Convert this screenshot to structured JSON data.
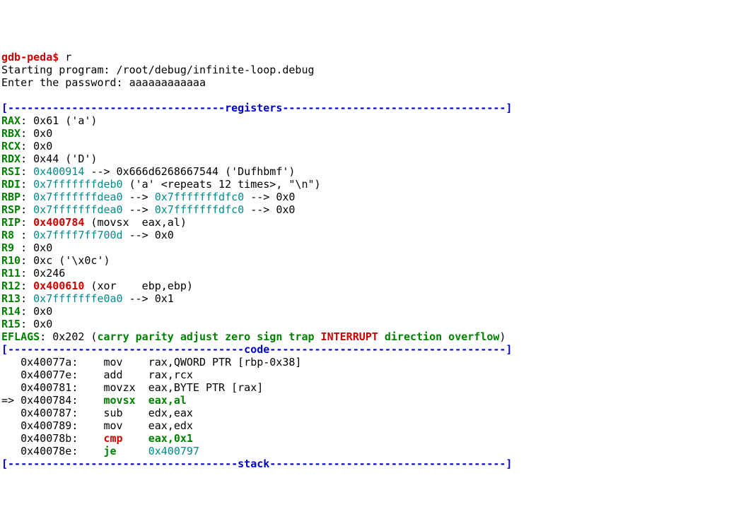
{
  "prompt": {
    "gdb": "gdb-peda$",
    "cmd": " r"
  },
  "lines": {
    "starting": "Starting program: /root/debug/infinite-loop.debug",
    "enterpw": "Enter the password: aaaaaaaaaaaa"
  },
  "blank": "",
  "sections": {
    "registers": "[----------------------------------registers-----------------------------------]",
    "code": "[-------------------------------------code-------------------------------------]",
    "stack": "[------------------------------------stack-------------------------------------]"
  },
  "reg": {
    "RAX": {
      "name": "RAX",
      "rest": ": 0x61 ('a')"
    },
    "RBX": {
      "name": "RBX",
      "rest": ": 0x0 "
    },
    "RCX": {
      "name": "RCX",
      "rest": ": 0x0 "
    },
    "RDX": {
      "name": "RDX",
      "rest": ": 0x44 ('D')"
    },
    "RSI": {
      "name": "RSI",
      "colon": ": ",
      "addr": "0x400914",
      "rest": " --> 0x666d6268667544 ('Dufhbmf')"
    },
    "RDI": {
      "name": "RDI",
      "colon": ": ",
      "addr": "0x7fffffffdeb0",
      "rest": " ('a' <repeats 12 times>, \"\\n\")"
    },
    "RBP": {
      "name": "RBP",
      "colon": ": ",
      "addr": "0x7fffffffdea0",
      "arrow1": " --> ",
      "addr2": "0x7fffffffdfc0",
      "rest": " --> 0x0 "
    },
    "RSP": {
      "name": "RSP",
      "colon": ": ",
      "addr": "0x7fffffffdea0",
      "arrow1": " --> ",
      "addr2": "0x7fffffffdfc0",
      "rest": " --> 0x0 "
    },
    "RIP": {
      "name": "RIP",
      "colon": ": ",
      "addr": "0x400784",
      "rest": " (movsx  eax,al)"
    },
    "R8": {
      "name": "R8 ",
      "colon": ": ",
      "addr": "0x7ffff7ff700d",
      "rest": " --> 0x0 "
    },
    "R9": {
      "name": "R9 ",
      "rest": ": 0x0 "
    },
    "R10": {
      "name": "R10",
      "rest": ": 0xc ('\\x0c')"
    },
    "R11": {
      "name": "R11",
      "rest": ": 0x246 "
    },
    "R12": {
      "name": "R12",
      "colon": ": ",
      "addr": "0x400610",
      "rest": " (xor    ebp,ebp)"
    },
    "R13": {
      "name": "R13",
      "colon": ": ",
      "addr": "0x7fffffffe0a0",
      "rest": " --> 0x1 "
    },
    "R14": {
      "name": "R14",
      "rest": ": 0x0 "
    },
    "R15": {
      "name": "R15",
      "rest": ": 0x0 "
    }
  },
  "eflags": {
    "name": "EFLAGS",
    "pre": ": 0x202 (",
    "flags_green1": "carry parity adjust zero sign trap ",
    "flags_red": "INTERRUPT",
    "flags_green2": " direction overflow",
    "close": ")"
  },
  "code": {
    "l0": "   0x40077a:    mov    rax,QWORD PTR [rbp-0x38]",
    "l1": "   0x40077e:    add    rax,rcx",
    "l2": "   0x400781:    movzx  eax,BYTE PTR [rax]",
    "l3_pre": "=> 0x400784:    ",
    "l3_mn": "movsx  ",
    "l3_ops": "eax,al",
    "l4": "   0x400787:    sub    edx,eax",
    "l5": "   0x400789:    mov    eax,edx",
    "l6_pre": "   0x40078b:    ",
    "l6_mn": "cmp    ",
    "l6_ops": "eax,0x1",
    "l7_pre": "   0x40078e:    ",
    "l7_mn": "je     ",
    "l7_ops": "0x400797"
  }
}
